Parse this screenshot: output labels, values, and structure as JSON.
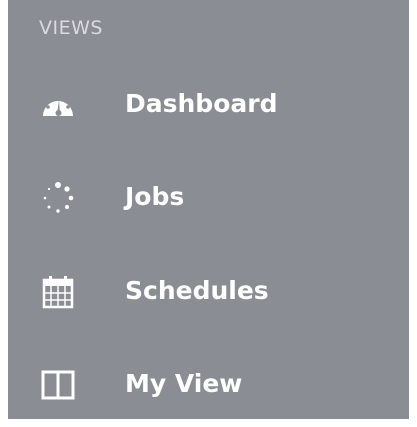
{
  "views": {
    "title": "VIEWS",
    "items": [
      {
        "label": "Dashboard",
        "icon": "dashboard-gauge-icon"
      },
      {
        "label": "Jobs",
        "icon": "spinner-dots-icon"
      },
      {
        "label": "Schedules",
        "icon": "calendar-icon"
      },
      {
        "label": "My View",
        "icon": "split-panel-icon"
      }
    ]
  },
  "colors": {
    "panel_background": "#8a8d94",
    "text": "#ffffff",
    "section_title": "#d9dbde"
  }
}
